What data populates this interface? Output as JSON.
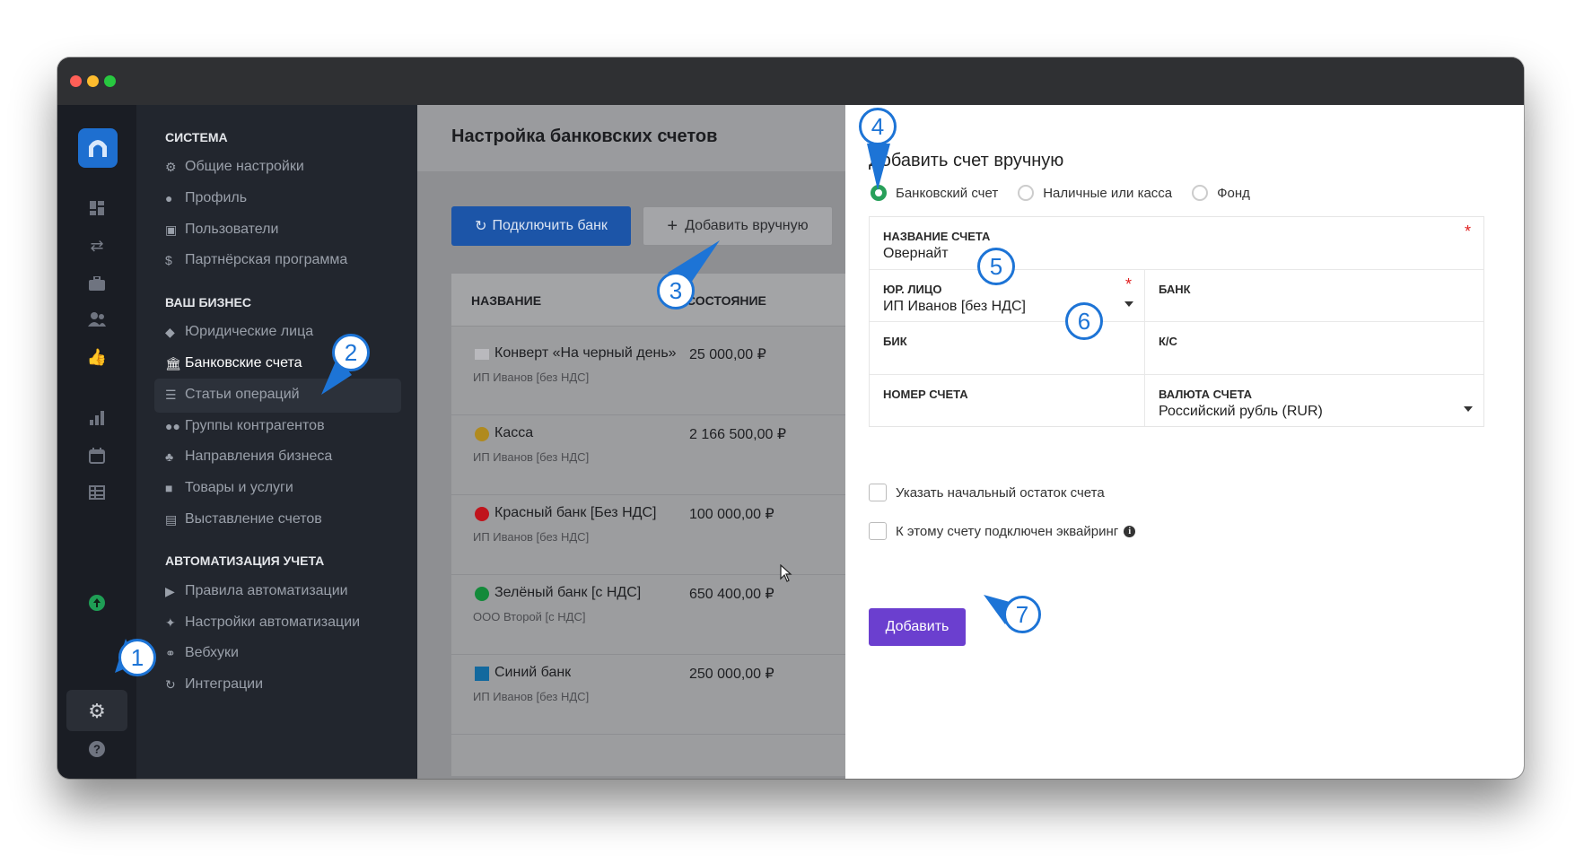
{
  "app": {
    "traffic_lights": [
      "#ff5f57",
      "#febc2e",
      "#28c840"
    ]
  },
  "rail": {
    "icons": [
      "dashboard-icon",
      "transfer-icon",
      "briefcase-icon",
      "users-icon",
      "thumbs-up-icon",
      "bar-chart-icon",
      "calendar-icon",
      "table-icon",
      "upgrade-icon",
      "gear-icon",
      "help-icon"
    ]
  },
  "menu": {
    "sections": [
      {
        "title": "СИСТЕМА",
        "items": [
          "Общие настройки",
          "Профиль",
          "Пользователи",
          "Партнёрская программа"
        ]
      },
      {
        "title": "ВАШ БИЗНЕС",
        "items": [
          "Юридические лица",
          "Банковские счета",
          "Статьи операций",
          "Группы контрагентов",
          "Направления бизнеса",
          "Товары и услуги",
          "Выставление счетов"
        ]
      },
      {
        "title": "АВТОМАТИЗАЦИЯ УЧЕТА",
        "items": [
          "Правила автоматизации",
          "Настройки автоматизации",
          "Вебхуки",
          "Интеграции"
        ]
      }
    ],
    "active_item": "Банковские счета"
  },
  "content": {
    "title": "Настройка банковских счетов",
    "connect_button": "Подключить банк",
    "manual_button": "Добавить вручную",
    "columns": [
      "НАЗВАНИЕ",
      "СОСТОЯНИЕ"
    ],
    "rows": [
      {
        "name": "Конверт «На черный день»",
        "entity": "ИП Иванов [без НДС]",
        "amount": "25 000,00 ₽",
        "color": "#b9b9bd"
      },
      {
        "name": "Касса",
        "entity": "ИП Иванов [без НДС]",
        "amount": "2 166 500,00 ₽",
        "color": "#b08a1e"
      },
      {
        "name": "Красный банк [Без НДС]",
        "entity": "ИП Иванов [без НДС]",
        "amount": "100 000,00 ₽",
        "color": "#c0141c"
      },
      {
        "name": "Зелёный банк [с НДС]",
        "entity": "ООО Второй [с НДС]",
        "amount": "650 400,00 ₽",
        "color": "#138a3a"
      },
      {
        "name": "Синий банк",
        "entity": "ИП Иванов [без НДС]",
        "amount": "250 000,00 ₽",
        "color": "#13699e"
      }
    ]
  },
  "form": {
    "title": "Добавить счет вручную",
    "account_types": [
      "Банковский счет",
      "Наличные или касса",
      "Фонд"
    ],
    "selected_type": "Банковский счет",
    "fields": {
      "account_name": {
        "label": "НАЗВАНИЕ СЧЕТА",
        "value": "Овернайт"
      },
      "legal_entity": {
        "label": "ЮР. ЛИЦО",
        "value": "ИП Иванов [без НДС]"
      },
      "bank": {
        "label": "БАНК",
        "value": ""
      },
      "bik": {
        "label": "БИК",
        "value": ""
      },
      "ks": {
        "label": "К/С",
        "value": ""
      },
      "account_number": {
        "label": "НОМЕР СЧЕТА",
        "value": ""
      },
      "currency": {
        "label": "ВАЛЮТА СЧЕТА",
        "value": "Российский рубль (RUR)"
      }
    },
    "required_mark": "*",
    "opening_balance_label": "Указать начальный остаток счета",
    "acquiring_label": "К этому счету подключен эквайринг",
    "submit_label": "Добавить"
  },
  "callouts": [
    "1",
    "2",
    "3",
    "4",
    "5",
    "6",
    "7"
  ],
  "colors": {
    "accent_blue": "#1d74d6",
    "primary_button": "#1c55a8",
    "submit_button": "#6b3fcf",
    "radio_selected": "#28a05a"
  }
}
